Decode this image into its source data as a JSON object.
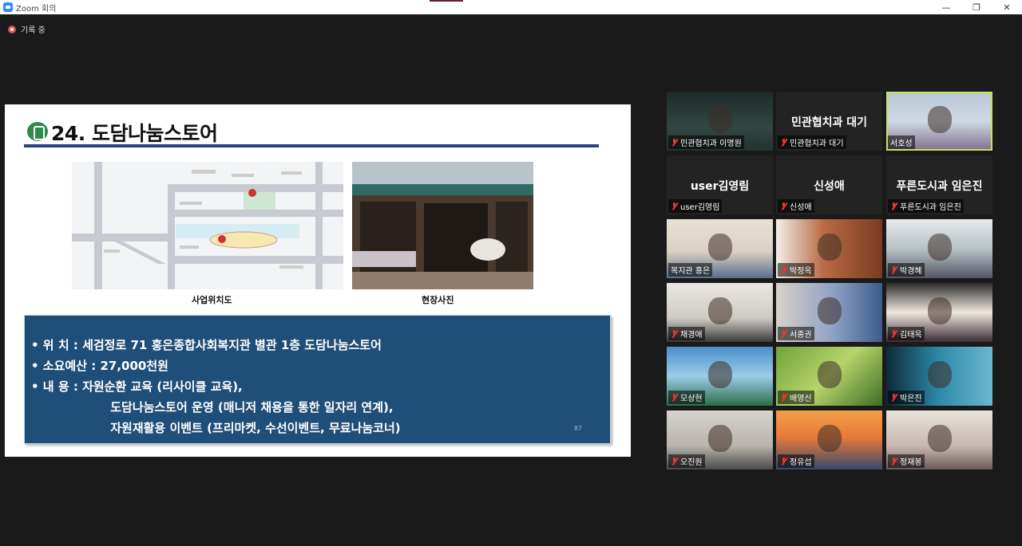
{
  "window": {
    "title": "Zoom 회의",
    "controls": {
      "minimize": "—",
      "maximize": "❐",
      "close": "✕"
    }
  },
  "recording": {
    "label": "기록 중"
  },
  "slide": {
    "title": "24. 도담나눔스토어",
    "caption_map": "사업위치도",
    "caption_photo": "현장사진",
    "lines": [
      "•  위      치 : 세검정로 71 홍은종합사회복지관 별관 1층 도담나눔스토어",
      "•  소요예산 : 27,000천원",
      "•  내      용 : 자원순환 교육 (리사이클 교육),",
      "                   도담나눔스토어 운영 (매니저 채용을 통한 일자리 연계),",
      "                   자원재활용 이벤트 (프리마켓, 수선이벤트, 무료나눔코너)"
    ],
    "page_number": "87"
  },
  "participants": [
    {
      "name": "민관협치과 이명원",
      "muted": true,
      "video": true,
      "highlight": false
    },
    {
      "name": "민관협치과 대기",
      "muted": true,
      "video": false,
      "big": "민관협치과 대기",
      "highlight": false
    },
    {
      "name": "서호성",
      "muted": false,
      "video": true,
      "highlight": true
    },
    {
      "name": "user김영림",
      "muted": true,
      "video": false,
      "big": "user김영림",
      "highlight": false
    },
    {
      "name": "신성애",
      "muted": true,
      "video": false,
      "big": "신성애",
      "highlight": false
    },
    {
      "name": "푸른도시과 임은진",
      "muted": true,
      "video": false,
      "big": "푸른도시과 임은진",
      "highlight": false
    },
    {
      "name": "복지관 홍은",
      "muted": false,
      "video": true,
      "highlight": false
    },
    {
      "name": "박정옥",
      "muted": true,
      "video": true,
      "highlight": false
    },
    {
      "name": "박경혜",
      "muted": true,
      "video": true,
      "highlight": false
    },
    {
      "name": "채경애",
      "muted": true,
      "video": true,
      "highlight": false
    },
    {
      "name": "서종권",
      "muted": true,
      "video": true,
      "highlight": false
    },
    {
      "name": "김태옥",
      "muted": true,
      "video": true,
      "highlight": false
    },
    {
      "name": "모상현",
      "muted": true,
      "video": true,
      "highlight": false
    },
    {
      "name": "배영신",
      "muted": true,
      "video": true,
      "highlight": false
    },
    {
      "name": "박은진",
      "muted": true,
      "video": true,
      "highlight": false
    },
    {
      "name": "오진원",
      "muted": true,
      "video": true,
      "highlight": false
    },
    {
      "name": "정유섭",
      "muted": true,
      "video": true,
      "highlight": false
    },
    {
      "name": "정재봉",
      "muted": true,
      "video": true,
      "highlight": false
    }
  ]
}
